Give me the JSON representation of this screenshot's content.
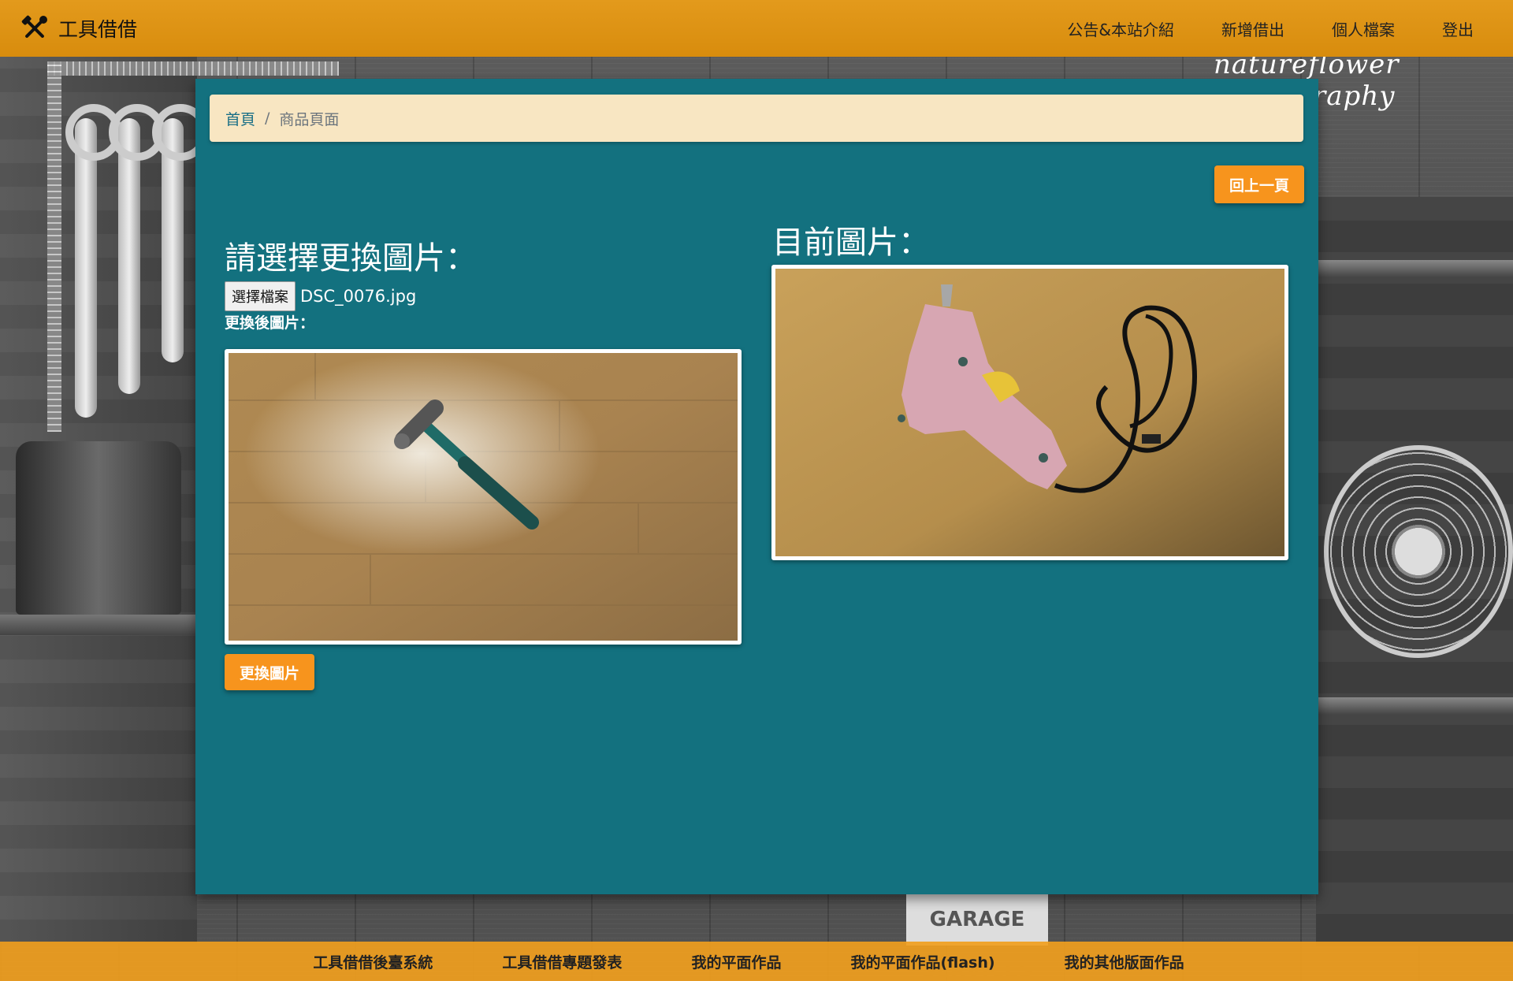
{
  "header": {
    "brand_text": "工具借借",
    "nav": [
      "公告&本站介紹",
      "新增借出",
      "個人檔案",
      "登出"
    ]
  },
  "background": {
    "watermark": "natureflower photography",
    "sign_text": "GARAGE SERVICES"
  },
  "breadcrumb": {
    "home": "首頁",
    "separator": "/",
    "current": "商品頁面"
  },
  "actions": {
    "back_label": "回上一頁",
    "change_label": "更換圖片"
  },
  "upload": {
    "title": "請選擇更換圖片：",
    "file_button": "選擇檔案",
    "file_name": "DSC_0076.jpg",
    "after_label": "更換後圖片："
  },
  "current": {
    "title": "目前圖片："
  },
  "footer": {
    "links": [
      "工具借借後臺系統",
      "工具借借專題發表",
      "我的平面作品",
      "我的平面作品(flash)",
      "我的其他版面作品"
    ]
  },
  "colors": {
    "header": "#d88c0d",
    "panel": "#13717f",
    "breadcrumb_bg": "#f8e6c2",
    "button": "#f7941d"
  }
}
